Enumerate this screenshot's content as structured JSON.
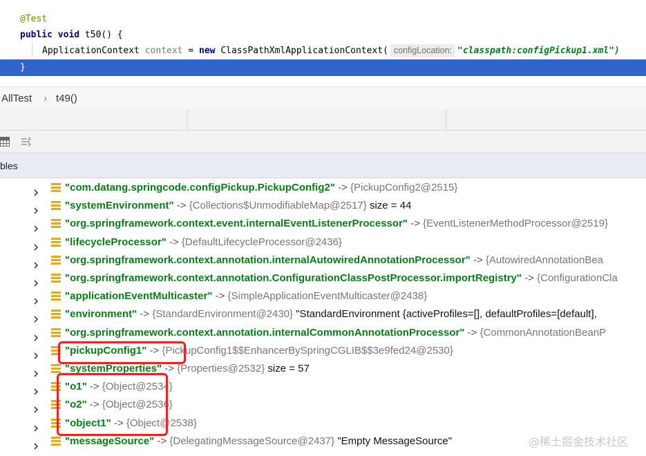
{
  "code": {
    "annotation": "@Test",
    "method_keywords": "public void",
    "method_name": "t50() {",
    "line3_type": "ApplicationContext",
    "line3_var": "context",
    "line3_eq": "=",
    "line3_new": "new",
    "line3_class": "ClassPathXmlApplicationContext(",
    "line3_hint": "configLocation:",
    "line3_string": "\"classpath:configPickup1.xml\")",
    "closing_brace": "}"
  },
  "breadcrumb": {
    "class_name": "AllTest",
    "separator": "›",
    "method": "t49()"
  },
  "variables_header": "bles",
  "tree_rows": [
    {
      "key": "\"com.datang.springcode.configPickup.PickupConfig2\"",
      "ref": "{PickupConfig2@2515}",
      "extra": ""
    },
    {
      "key": "\"systemEnvironment\"",
      "ref": "{Collections$UnmodifiableMap@2517}",
      "extra": "size = 44"
    },
    {
      "key": "\"org.springframework.context.event.internalEventListenerProcessor\"",
      "ref": "{EventListenerMethodProcessor@2519}",
      "extra": ""
    },
    {
      "key": "\"lifecycleProcessor\"",
      "ref": "{DefaultLifecycleProcessor@2436}",
      "extra": ""
    },
    {
      "key": "\"org.springframework.context.annotation.internalAutowiredAnnotationProcessor\"",
      "ref": "{AutowiredAnnotationBea",
      "extra": ""
    },
    {
      "key": "\"org.springframework.context.annotation.ConfigurationClassPostProcessor.importRegistry\"",
      "ref": "{ConfigurationCla",
      "extra": ""
    },
    {
      "key": "\"applicationEventMulticaster\"",
      "ref": "{SimpleApplicationEventMulticaster@2438}",
      "extra": ""
    },
    {
      "key": "\"environment\"",
      "ref": "{StandardEnvironment@2430}",
      "extra": "\"StandardEnvironment {activeProfiles=[], defaultProfiles=[default],"
    },
    {
      "key": "\"org.springframework.context.annotation.internalCommonAnnotationProcessor\"",
      "ref": "{CommonAnnotationBeanP",
      "extra": ""
    },
    {
      "key": "\"pickupConfig1\"",
      "ref": "{PickupConfig1$$EnhancerBySpringCGLIB$$3e9fed24@2530}",
      "extra": ""
    },
    {
      "key": "\"systemProperties\"",
      "ref": "{Properties@2532}",
      "extra": "size = 57"
    },
    {
      "key": "\"o1\"",
      "ref": "{Object@2534}",
      "extra": ""
    },
    {
      "key": "\"o2\"",
      "ref": "{Object@2536}",
      "extra": ""
    },
    {
      "key": "\"object1\"",
      "ref": "{Object@2538}",
      "extra": ""
    },
    {
      "key": "\"messageSource\"",
      "ref": "{DelegatingMessageSource@2437}",
      "extra": "\"Empty MessageSource\""
    }
  ],
  "arrow": "->",
  "watermark": "@稀土掘金技术社区",
  "colors": {
    "selection": "#2f65ca",
    "key_green": "#067d17",
    "highlight_red": "#f02020",
    "field_icon": "#e6a817"
  },
  "icons": {
    "expand": "chevron-right-icon",
    "field": "field-icon",
    "toolbar_left": "table-icon",
    "toolbar_right": "restore-layout-icon"
  }
}
